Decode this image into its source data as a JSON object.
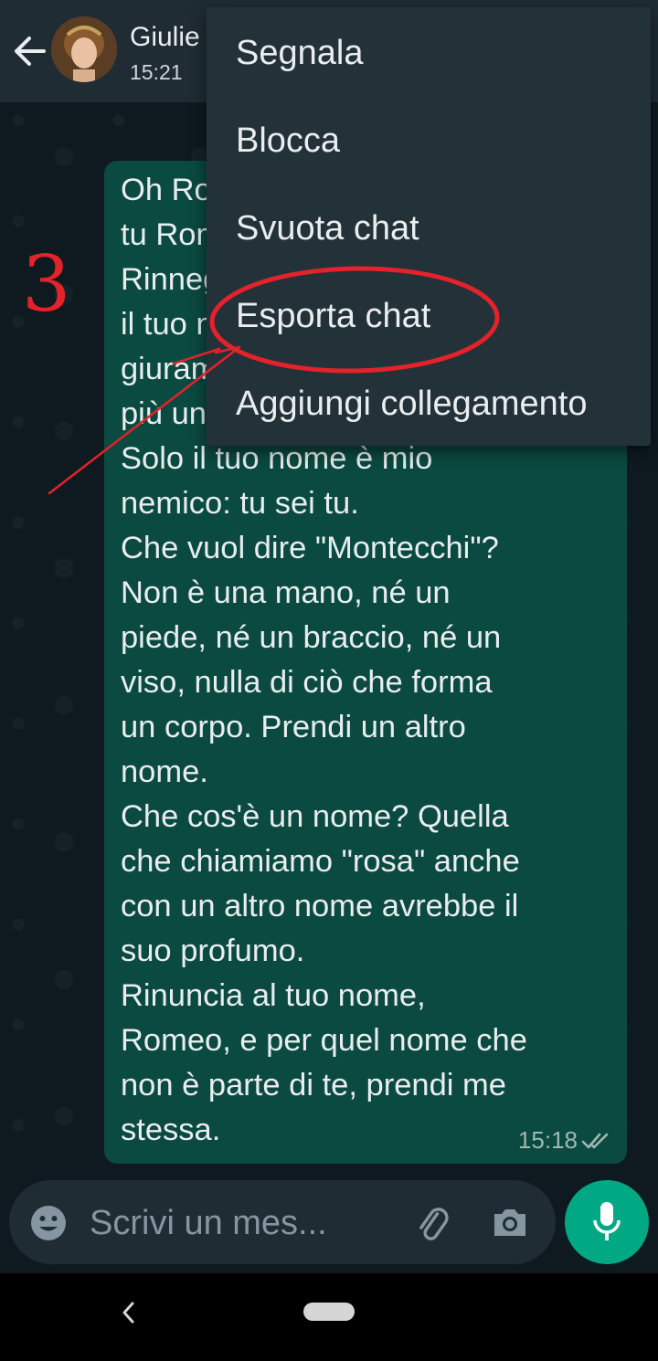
{
  "header": {
    "contact_name": "Giulie",
    "last_seen": "15:21"
  },
  "message": {
    "text": "Oh Romeo, Romeo! Perché sei\ntu Romeo?\nRinnega tuo padre, rifiuta\nil tuo nome; o, se non vuoi,\ngiurami amore e non sarò\npiù una Capuleti.\nSolo il tuo nome è mio\nnemico: tu sei tu.\nChe vuol dire \"Montecchi\"?\nNon è una mano, né un\npiede, né un braccio, né un\nviso, nulla di ciò che forma\nun corpo. Prendi un altro\nnome.\nChe cos'è un nome? Quella\nche chiamiamo \"rosa\" anche\ncon un altro nome avrebbe il\nsuo profumo.\nRinuncia al tuo nome,\nRomeo, e per quel nome che\nnon è parte di te, prendi me\nstessa.",
    "time": "15:18"
  },
  "menu": {
    "items": [
      {
        "label": "Segnala"
      },
      {
        "label": "Blocca"
      },
      {
        "label": "Svuota chat"
      },
      {
        "label": "Esporta chat"
      },
      {
        "label": "Aggiungi collegamento"
      }
    ]
  },
  "annotation": {
    "step_number": "3",
    "color": "#e3222b"
  },
  "composer": {
    "placeholder": "Scrivi un mes..."
  },
  "colors": {
    "header_bg": "#1f2c34",
    "bubble_bg": "#0a4a40",
    "accent": "#00a884",
    "menu_bg": "#233138"
  },
  "icons": {
    "back": "arrow-left-icon",
    "emoji": "emoji-icon",
    "attach": "paperclip-icon",
    "camera": "camera-icon",
    "mic": "mic-icon",
    "read": "double-check-icon"
  }
}
